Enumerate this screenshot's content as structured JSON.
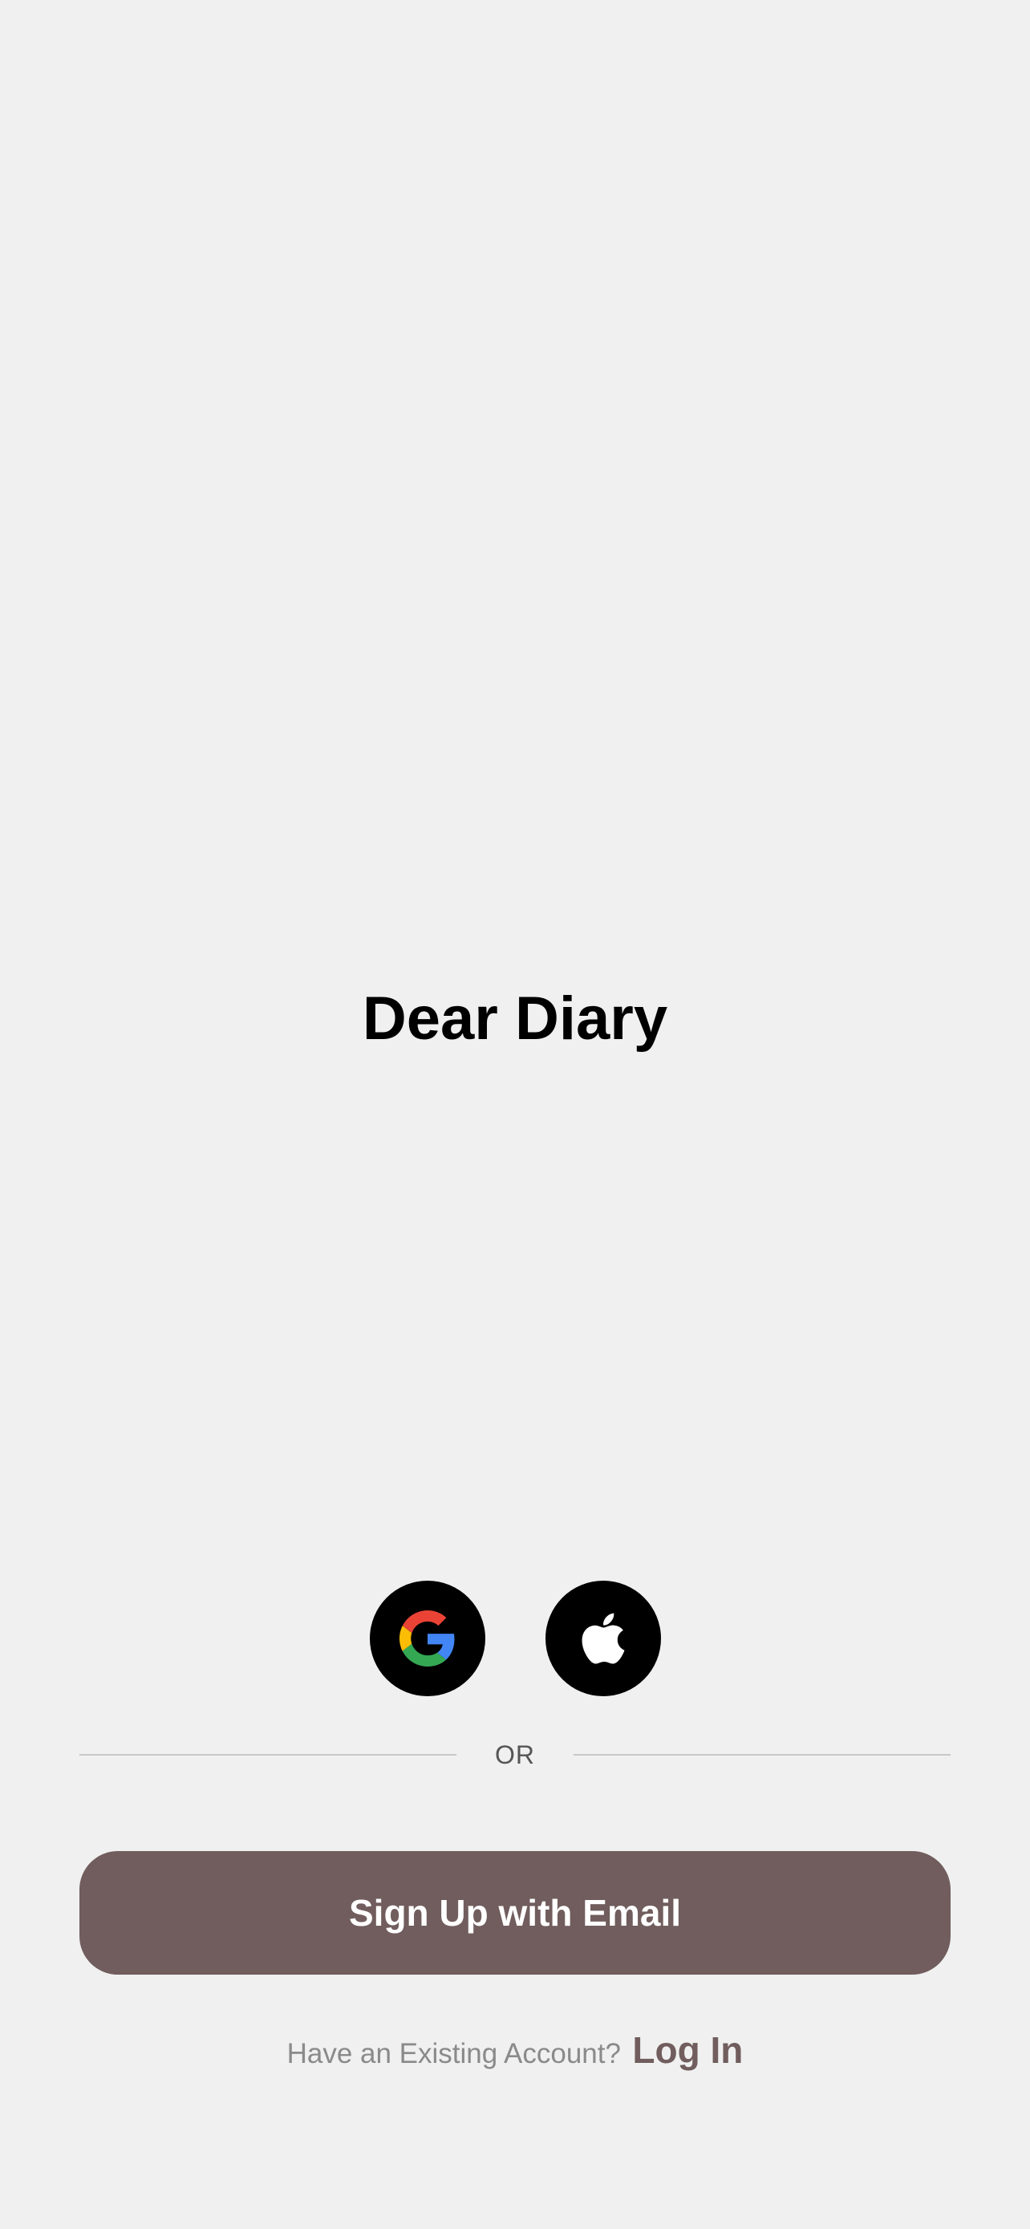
{
  "app": {
    "title": "Dear Diary"
  },
  "social": {
    "google_icon": "google-g-icon",
    "apple_icon": "apple-logo-icon",
    "button_color": "#000000"
  },
  "divider": {
    "label": "OR"
  },
  "signup": {
    "email_button_label": "Sign Up with Email",
    "button_color": "#715d5d"
  },
  "login": {
    "prompt": "Have an Existing Account?",
    "link_label": "Log In",
    "link_color": "#715d5d"
  },
  "theme": {
    "background": "#f0f0f0"
  }
}
